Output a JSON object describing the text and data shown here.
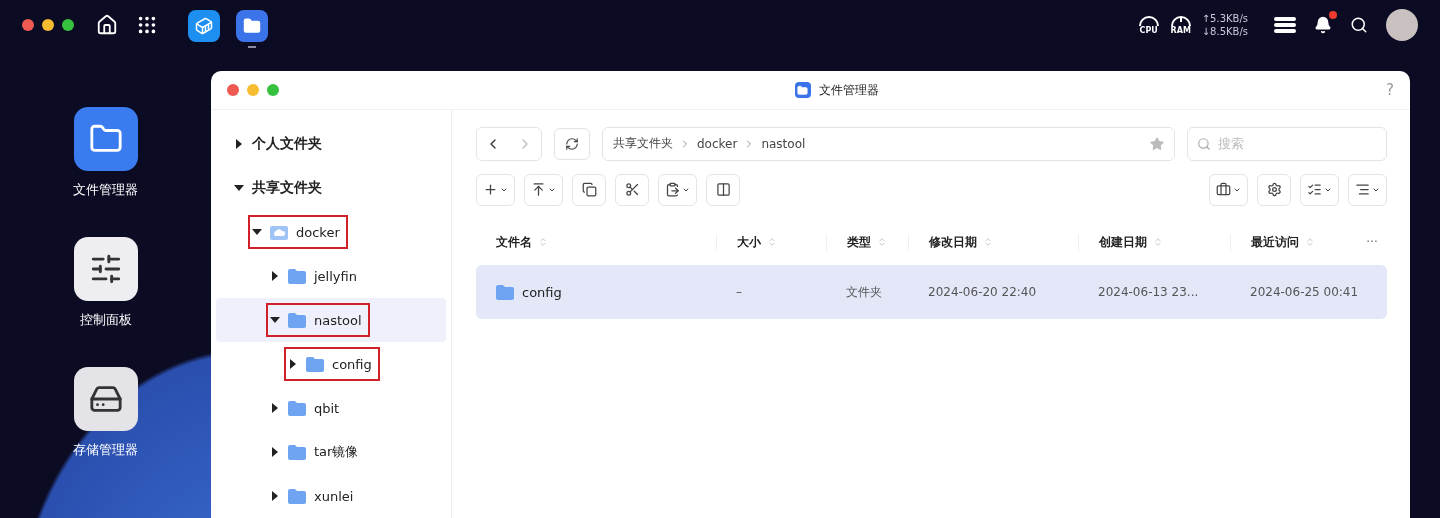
{
  "top_bar": {
    "apps": [
      {
        "kind": "docker",
        "selected": false
      },
      {
        "kind": "files",
        "selected": true
      }
    ],
    "cpu_label": "CPU",
    "ram_label": "RAM",
    "upload": "↑5.3KB/s",
    "download": "↓8.5KB/s",
    "has_notification": true
  },
  "desktop_icons": [
    {
      "kind": "files",
      "label": "文件管理器"
    },
    {
      "kind": "control",
      "label": "控制面板"
    },
    {
      "kind": "storage",
      "label": "存储管理器"
    }
  ],
  "window": {
    "title": "文件管理器",
    "help": "?"
  },
  "sidebar": {
    "items": [
      {
        "label": "个人文件夹",
        "kind": "root",
        "expanded": false,
        "selected": false,
        "annotated": false
      },
      {
        "label": "共享文件夹",
        "kind": "root",
        "expanded": true,
        "selected": false,
        "annotated": false,
        "children": [
          {
            "label": "docker",
            "kind": "shared",
            "expanded": true,
            "selected": false,
            "annotated": true,
            "children": [
              {
                "label": "jellyfin",
                "kind": "folder",
                "expanded": false,
                "selected": false,
                "annotated": false
              },
              {
                "label": "nastool",
                "kind": "folder",
                "expanded": true,
                "selected": true,
                "annotated": true,
                "children": [
                  {
                    "label": "config",
                    "kind": "folder",
                    "expanded": false,
                    "selected": false,
                    "annotated": true
                  }
                ]
              },
              {
                "label": "qbit",
                "kind": "folder",
                "expanded": false,
                "selected": false,
                "annotated": false
              },
              {
                "label": "tar镜像",
                "kind": "folder",
                "expanded": false,
                "selected": false,
                "annotated": false
              },
              {
                "label": "xunlei",
                "kind": "folder",
                "expanded": false,
                "selected": false,
                "annotated": false
              }
            ]
          }
        ]
      }
    ]
  },
  "breadcrumb": [
    "共享文件夹",
    "docker",
    "nastool"
  ],
  "search": {
    "placeholder": "搜索"
  },
  "toolbar_left": [
    {
      "kind": "new",
      "caret": true
    },
    {
      "kind": "upload",
      "caret": true
    },
    {
      "kind": "copy",
      "caret": false
    },
    {
      "kind": "cut",
      "caret": false
    },
    {
      "kind": "paste",
      "caret": true
    },
    {
      "kind": "compress",
      "caret": false
    }
  ],
  "toolbar_right": [
    {
      "kind": "briefcase",
      "caret": true
    },
    {
      "kind": "settings",
      "caret": false
    },
    {
      "kind": "list",
      "caret": true
    },
    {
      "kind": "sort",
      "caret": true
    }
  ],
  "table": {
    "columns": [
      "文件名",
      "大小",
      "类型",
      "修改日期",
      "创建日期",
      "最近访问"
    ],
    "more": "···",
    "rows": [
      {
        "selected": true,
        "cells": [
          "config",
          "–",
          "文件夹",
          "2024-06-20 22:40",
          "2024-06-13 23...",
          "2024-06-25 00:41"
        ]
      }
    ]
  }
}
